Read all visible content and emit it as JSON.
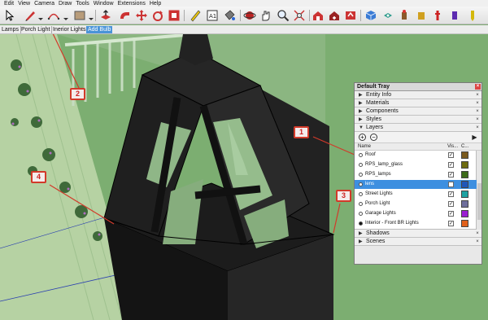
{
  "menu": [
    "Edit",
    "View",
    "Camera",
    "Draw",
    "Tools",
    "Window",
    "Extensions",
    "Help"
  ],
  "toolbar_icons": [
    "select-arrow-icon",
    "line-pencil-icon",
    "arc-icon",
    "rectangle-icon",
    "push-pull-icon",
    "follow-me-icon",
    "move-icon",
    "rotate-icon",
    "offset-icon",
    "tape-measure-icon",
    "text-icon",
    "paint-bucket-icon",
    "orbit-icon",
    "pan-icon",
    "zoom-icon",
    "zoom-extents-icon",
    "warehouse-icon",
    "extension-warehouse-icon",
    "share-model-icon",
    "iso-view-icon",
    "top-view-icon",
    "front-view-icon",
    "right-view-icon",
    "back-view-icon",
    "left-view-icon",
    "bottom-view-icon"
  ],
  "scene_tabs": [
    {
      "label": "Lamps",
      "active": false
    },
    {
      "label": "Porch Light",
      "active": false
    },
    {
      "label": "Inerior Lights",
      "active": false
    },
    {
      "label": "Add Bulb",
      "active": true
    }
  ],
  "callouts": [
    "1",
    "2",
    "3",
    "4"
  ],
  "tray": {
    "title": "Default Tray",
    "panels_top": [
      {
        "label": "Entity Info"
      },
      {
        "label": "Materials"
      },
      {
        "label": "Components"
      },
      {
        "label": "Styles"
      }
    ],
    "layers_label": "Layers",
    "layers_header": {
      "name": "Name",
      "visible": "Vis...",
      "color": "C..."
    },
    "layers": [
      {
        "name": "Roof",
        "visible": true,
        "active": false,
        "selected": false,
        "color": "#7a5a1e"
      },
      {
        "name": "RPS_lamp_glass",
        "visible": true,
        "active": false,
        "selected": false,
        "color": "#6d6b10"
      },
      {
        "name": "RPS_lamps",
        "visible": true,
        "active": false,
        "selected": false,
        "color": "#3d6b1a"
      },
      {
        "name": "lens",
        "visible": false,
        "active": false,
        "selected": true,
        "color": "#1f56b8"
      },
      {
        "name": "Street Lights",
        "visible": true,
        "active": false,
        "selected": false,
        "color": "#1fa3a3"
      },
      {
        "name": "Porch Light",
        "visible": true,
        "active": false,
        "selected": false,
        "color": "#6f6f9c"
      },
      {
        "name": "Garage Lights",
        "visible": true,
        "active": false,
        "selected": false,
        "color": "#9a1fd2"
      },
      {
        "name": "Interior - Front BR Lights",
        "visible": true,
        "active": true,
        "selected": false,
        "color": "#e0601b"
      }
    ],
    "panels_bottom": [
      {
        "label": "Shadows"
      },
      {
        "label": "Scenes"
      }
    ]
  },
  "colors": {
    "accent_tab": "#4a94d8",
    "selection": "#3d8fe0",
    "callout_border": "#d23a2a",
    "model_dark": "#1f1f1f"
  }
}
